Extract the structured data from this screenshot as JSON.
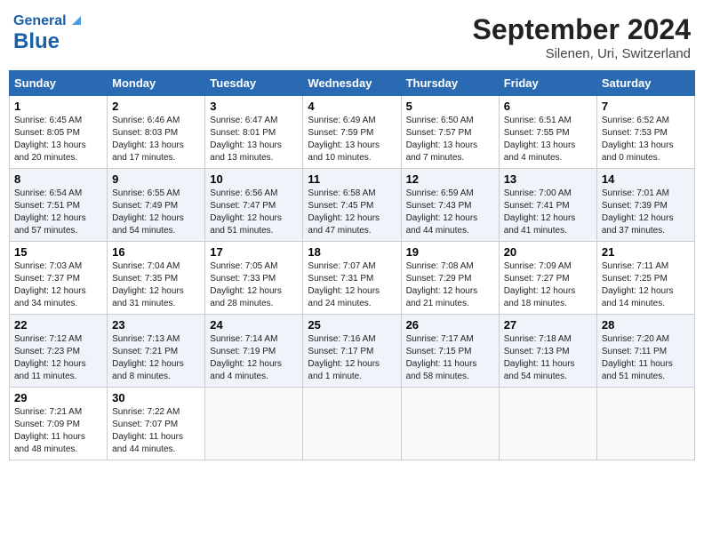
{
  "header": {
    "logo_general": "General",
    "logo_blue": "Blue",
    "month": "September 2024",
    "location": "Silenen, Uri, Switzerland"
  },
  "weekdays": [
    "Sunday",
    "Monday",
    "Tuesday",
    "Wednesday",
    "Thursday",
    "Friday",
    "Saturday"
  ],
  "weeks": [
    [
      {
        "day": "1",
        "sunrise": "Sunrise: 6:45 AM",
        "sunset": "Sunset: 8:05 PM",
        "daylight": "Daylight: 13 hours and 20 minutes."
      },
      {
        "day": "2",
        "sunrise": "Sunrise: 6:46 AM",
        "sunset": "Sunset: 8:03 PM",
        "daylight": "Daylight: 13 hours and 17 minutes."
      },
      {
        "day": "3",
        "sunrise": "Sunrise: 6:47 AM",
        "sunset": "Sunset: 8:01 PM",
        "daylight": "Daylight: 13 hours and 13 minutes."
      },
      {
        "day": "4",
        "sunrise": "Sunrise: 6:49 AM",
        "sunset": "Sunset: 7:59 PM",
        "daylight": "Daylight: 13 hours and 10 minutes."
      },
      {
        "day": "5",
        "sunrise": "Sunrise: 6:50 AM",
        "sunset": "Sunset: 7:57 PM",
        "daylight": "Daylight: 13 hours and 7 minutes."
      },
      {
        "day": "6",
        "sunrise": "Sunrise: 6:51 AM",
        "sunset": "Sunset: 7:55 PM",
        "daylight": "Daylight: 13 hours and 4 minutes."
      },
      {
        "day": "7",
        "sunrise": "Sunrise: 6:52 AM",
        "sunset": "Sunset: 7:53 PM",
        "daylight": "Daylight: 13 hours and 0 minutes."
      }
    ],
    [
      {
        "day": "8",
        "sunrise": "Sunrise: 6:54 AM",
        "sunset": "Sunset: 7:51 PM",
        "daylight": "Daylight: 12 hours and 57 minutes."
      },
      {
        "day": "9",
        "sunrise": "Sunrise: 6:55 AM",
        "sunset": "Sunset: 7:49 PM",
        "daylight": "Daylight: 12 hours and 54 minutes."
      },
      {
        "day": "10",
        "sunrise": "Sunrise: 6:56 AM",
        "sunset": "Sunset: 7:47 PM",
        "daylight": "Daylight: 12 hours and 51 minutes."
      },
      {
        "day": "11",
        "sunrise": "Sunrise: 6:58 AM",
        "sunset": "Sunset: 7:45 PM",
        "daylight": "Daylight: 12 hours and 47 minutes."
      },
      {
        "day": "12",
        "sunrise": "Sunrise: 6:59 AM",
        "sunset": "Sunset: 7:43 PM",
        "daylight": "Daylight: 12 hours and 44 minutes."
      },
      {
        "day": "13",
        "sunrise": "Sunrise: 7:00 AM",
        "sunset": "Sunset: 7:41 PM",
        "daylight": "Daylight: 12 hours and 41 minutes."
      },
      {
        "day": "14",
        "sunrise": "Sunrise: 7:01 AM",
        "sunset": "Sunset: 7:39 PM",
        "daylight": "Daylight: 12 hours and 37 minutes."
      }
    ],
    [
      {
        "day": "15",
        "sunrise": "Sunrise: 7:03 AM",
        "sunset": "Sunset: 7:37 PM",
        "daylight": "Daylight: 12 hours and 34 minutes."
      },
      {
        "day": "16",
        "sunrise": "Sunrise: 7:04 AM",
        "sunset": "Sunset: 7:35 PM",
        "daylight": "Daylight: 12 hours and 31 minutes."
      },
      {
        "day": "17",
        "sunrise": "Sunrise: 7:05 AM",
        "sunset": "Sunset: 7:33 PM",
        "daylight": "Daylight: 12 hours and 28 minutes."
      },
      {
        "day": "18",
        "sunrise": "Sunrise: 7:07 AM",
        "sunset": "Sunset: 7:31 PM",
        "daylight": "Daylight: 12 hours and 24 minutes."
      },
      {
        "day": "19",
        "sunrise": "Sunrise: 7:08 AM",
        "sunset": "Sunset: 7:29 PM",
        "daylight": "Daylight: 12 hours and 21 minutes."
      },
      {
        "day": "20",
        "sunrise": "Sunrise: 7:09 AM",
        "sunset": "Sunset: 7:27 PM",
        "daylight": "Daylight: 12 hours and 18 minutes."
      },
      {
        "day": "21",
        "sunrise": "Sunrise: 7:11 AM",
        "sunset": "Sunset: 7:25 PM",
        "daylight": "Daylight: 12 hours and 14 minutes."
      }
    ],
    [
      {
        "day": "22",
        "sunrise": "Sunrise: 7:12 AM",
        "sunset": "Sunset: 7:23 PM",
        "daylight": "Daylight: 12 hours and 11 minutes."
      },
      {
        "day": "23",
        "sunrise": "Sunrise: 7:13 AM",
        "sunset": "Sunset: 7:21 PM",
        "daylight": "Daylight: 12 hours and 8 minutes."
      },
      {
        "day": "24",
        "sunrise": "Sunrise: 7:14 AM",
        "sunset": "Sunset: 7:19 PM",
        "daylight": "Daylight: 12 hours and 4 minutes."
      },
      {
        "day": "25",
        "sunrise": "Sunrise: 7:16 AM",
        "sunset": "Sunset: 7:17 PM",
        "daylight": "Daylight: 12 hours and 1 minute."
      },
      {
        "day": "26",
        "sunrise": "Sunrise: 7:17 AM",
        "sunset": "Sunset: 7:15 PM",
        "daylight": "Daylight: 11 hours and 58 minutes."
      },
      {
        "day": "27",
        "sunrise": "Sunrise: 7:18 AM",
        "sunset": "Sunset: 7:13 PM",
        "daylight": "Daylight: 11 hours and 54 minutes."
      },
      {
        "day": "28",
        "sunrise": "Sunrise: 7:20 AM",
        "sunset": "Sunset: 7:11 PM",
        "daylight": "Daylight: 11 hours and 51 minutes."
      }
    ],
    [
      {
        "day": "29",
        "sunrise": "Sunrise: 7:21 AM",
        "sunset": "Sunset: 7:09 PM",
        "daylight": "Daylight: 11 hours and 48 minutes."
      },
      {
        "day": "30",
        "sunrise": "Sunrise: 7:22 AM",
        "sunset": "Sunset: 7:07 PM",
        "daylight": "Daylight: 11 hours and 44 minutes."
      },
      null,
      null,
      null,
      null,
      null
    ]
  ]
}
